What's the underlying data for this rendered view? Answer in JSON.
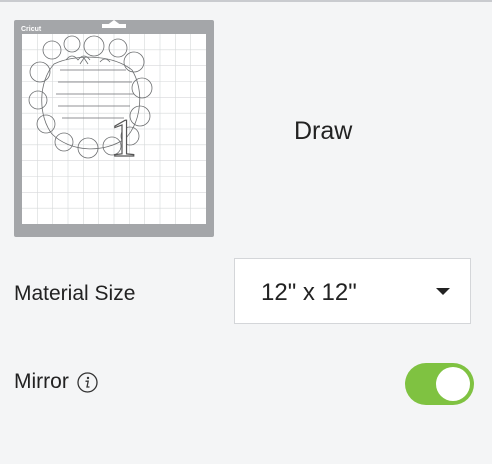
{
  "mat": {
    "brand": "Cricut",
    "type_label": "Draw",
    "preview_number": "1"
  },
  "material_size": {
    "label": "Material Size",
    "value": "12\" x 12\""
  },
  "mirror": {
    "label": "Mirror",
    "enabled": true,
    "accent_color": "#7fc241"
  }
}
